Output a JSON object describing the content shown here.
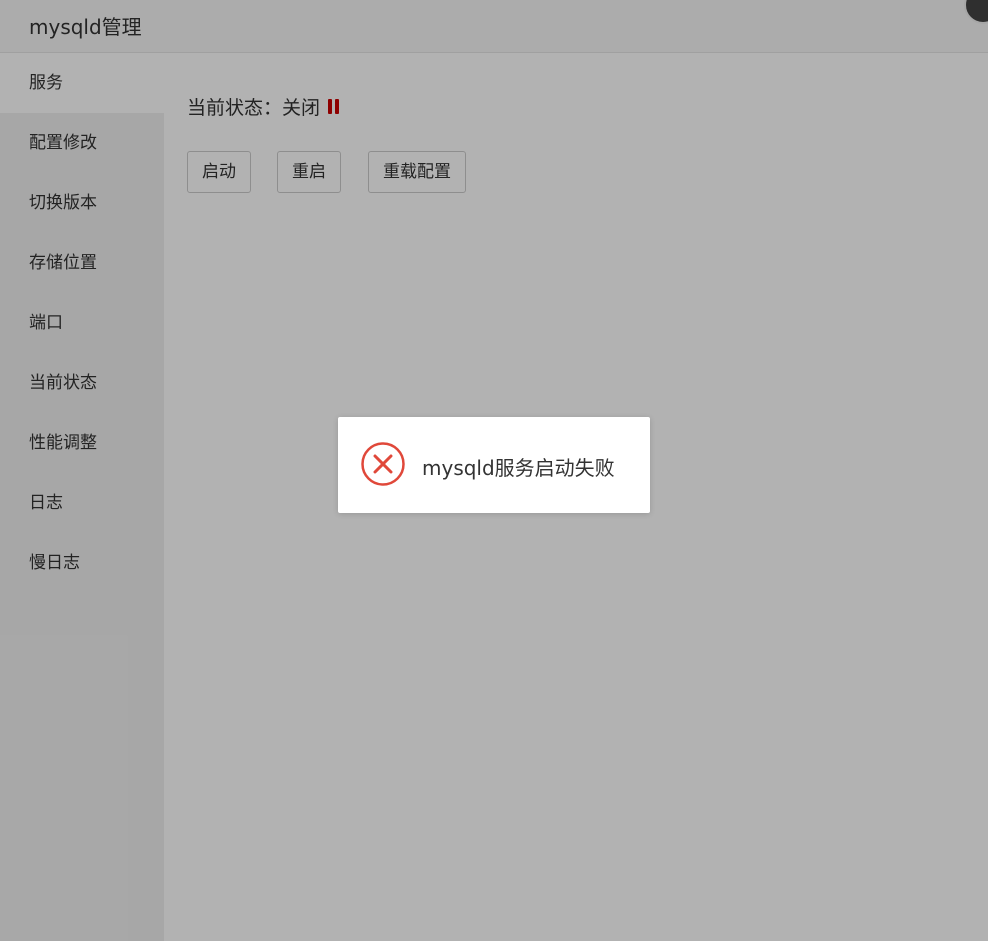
{
  "window": {
    "title": "mysqld管理"
  },
  "sidebar": {
    "items": [
      {
        "label": "服务",
        "active": true
      },
      {
        "label": "配置修改",
        "active": false
      },
      {
        "label": "切换版本",
        "active": false
      },
      {
        "label": "存储位置",
        "active": false
      },
      {
        "label": "端口",
        "active": false
      },
      {
        "label": "当前状态",
        "active": false
      },
      {
        "label": "性能调整",
        "active": false
      },
      {
        "label": "日志",
        "active": false
      },
      {
        "label": "慢日志",
        "active": false
      }
    ]
  },
  "main": {
    "status_label": "当前状态：",
    "status_value": "关闭",
    "status_icon": "pause-icon",
    "status_color": "#cc0000",
    "buttons": {
      "start": "启动",
      "restart": "重启",
      "reload": "重载配置"
    }
  },
  "toast": {
    "icon": "error-circle-icon",
    "icon_color": "#e0483a",
    "message": "mysqld服务启动失败"
  },
  "overlay_color": "rgba(0,0,0,0.3)"
}
